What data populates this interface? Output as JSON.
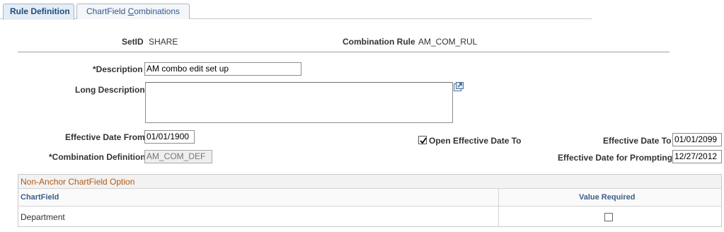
{
  "tabs": [
    {
      "label": "Rule Definition",
      "active": true
    },
    {
      "label_prefix": "ChartField ",
      "label_underlined": "C",
      "label_suffix": "ombinations",
      "active": false
    }
  ],
  "header": {
    "setid_label": "SetID",
    "setid_value": "SHARE",
    "combination_rule_label": "Combination Rule",
    "combination_rule_value": "AM_COM_RUL"
  },
  "form": {
    "description_label": "*Description",
    "description_value": "AM combo edit set up",
    "long_description_label": "Long Description",
    "long_description_value": "",
    "effective_date_from_label": "Effective Date From",
    "effective_date_from_value": "01/01/1900",
    "open_effective_date_to_label": "Open Effective Date To",
    "open_effective_date_to_checked": true,
    "effective_date_to_label": "Effective Date To",
    "effective_date_to_value": "01/01/2099",
    "combination_definition_label": "*Combination Definition",
    "combination_definition_value": "AM_COM_DEF",
    "effective_date_prompting_label": "Effective Date for Prompting",
    "effective_date_prompting_value": "12/27/2012"
  },
  "grid": {
    "title": "Non-Anchor ChartField Option",
    "columns": [
      "ChartField",
      "Value Required"
    ],
    "rows": [
      {
        "chartfield": "Department",
        "value_required": false
      }
    ]
  },
  "colors": {
    "accent_link": "#3b5d8c",
    "grid_title": "#b05a15",
    "tab_active_bg": "#e4ecf6"
  }
}
